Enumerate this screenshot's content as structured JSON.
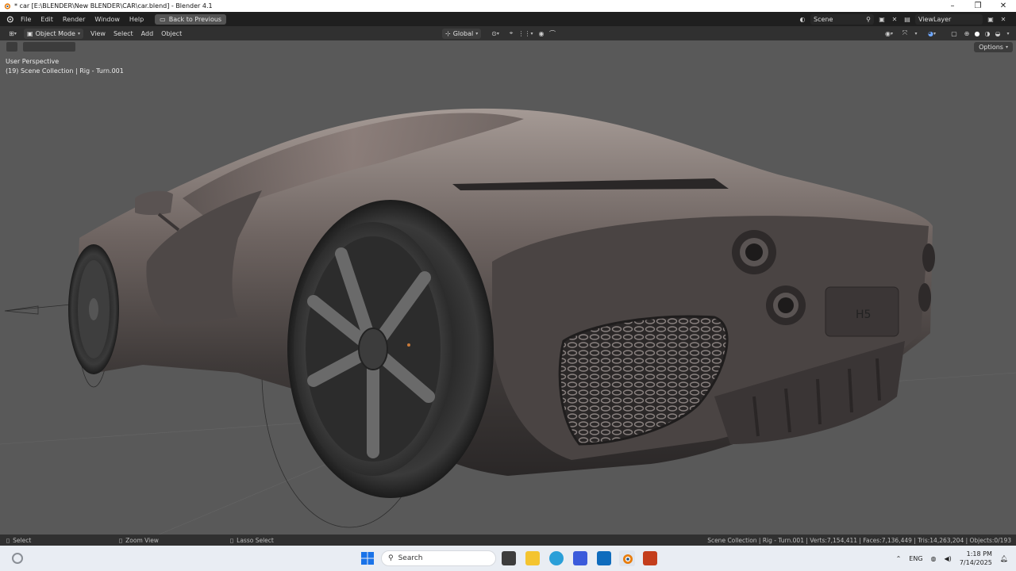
{
  "window": {
    "title": "* car [E:\\BLENDER\\New BLENDER\\CAR\\car.blend] - Blender 4.1",
    "minimize_icon": "–",
    "maximize_icon": "❐",
    "close_icon": "✕"
  },
  "topbar": {
    "menus": [
      "File",
      "Edit",
      "Render",
      "Window",
      "Help"
    ],
    "back_button": "Back to Previous",
    "scene": "Scene",
    "view_layer": "ViewLayer"
  },
  "viewport_header": {
    "mode": "Object Mode",
    "menus": [
      "View",
      "Select",
      "Add",
      "Object"
    ],
    "transform_orientation": "Global"
  },
  "viewport": {
    "perspective_label": "User Perspective",
    "collection_label": "(19) Scene Collection | Rig - Turn.001",
    "options_label": "Options",
    "background_color": "#595959",
    "emblem_text": "H5"
  },
  "statusbar": {
    "left_hints": [
      "Select",
      "Zoom View",
      "Lasso Select"
    ],
    "stats": "Scene Collection | Rig - Turn.001 | Verts:7,154,411 | Faces:7,136,449 | Tris:14,263,204 | Objects:0/193"
  },
  "taskbar": {
    "search_placeholder": "Search",
    "language": "ENG",
    "time": "1:18 PM",
    "date": "7/14/2025",
    "apps": [
      "task-view",
      "file-explorer",
      "edge",
      "store",
      "outlook",
      "blender",
      "powerpoint"
    ]
  }
}
